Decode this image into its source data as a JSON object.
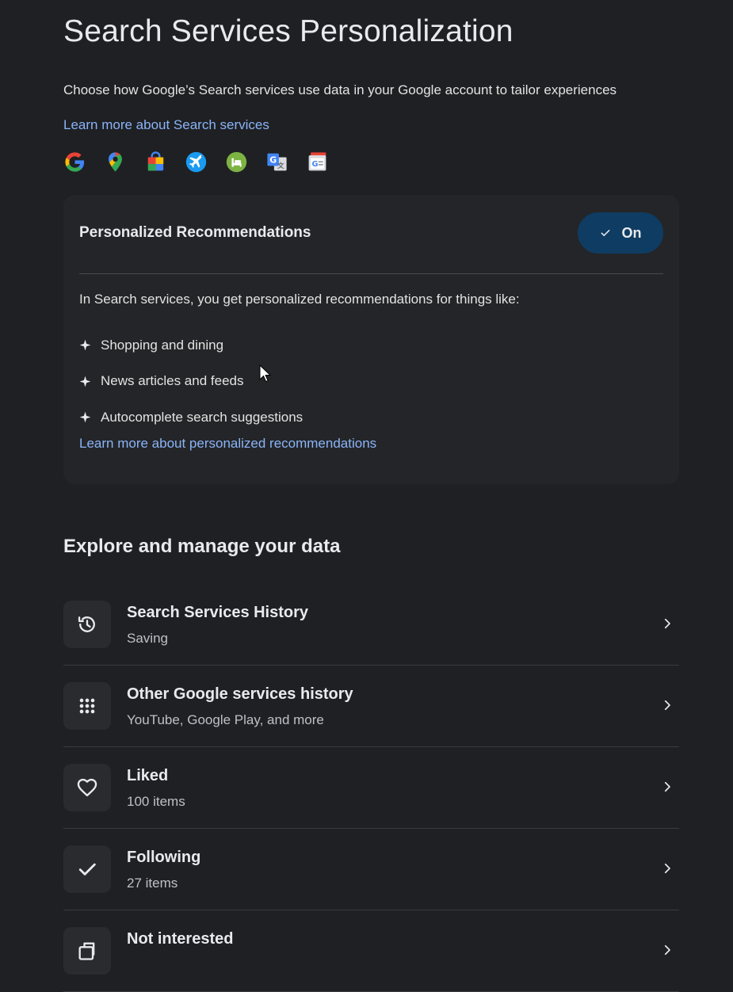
{
  "page": {
    "title": "Search Services Personalization",
    "intro": "Choose how Google’s Search services use data in your Google account to tailor experiences",
    "learn_more": "Learn more about Search services"
  },
  "service_icons": [
    "google-g-icon",
    "maps-pin-icon",
    "shopping-bag-icon",
    "flights-icon",
    "hotels-icon",
    "translate-icon",
    "news-icon"
  ],
  "recommendations": {
    "title": "Personalized Recommendations",
    "toggle_label": "On",
    "description": "In Search services, you get personalized recommendations for things like:",
    "items": [
      "Shopping and dining",
      "News articles and feeds",
      "Autocomplete search suggestions"
    ],
    "learn_more": "Learn more about personalized recommendations"
  },
  "explore": {
    "title": "Explore and manage your data",
    "rows": [
      {
        "title": "Search Services History",
        "subtitle": "Saving",
        "icon": "history-icon"
      },
      {
        "title": "Other Google services history",
        "subtitle": "YouTube, Google Play, and more",
        "icon": "apps-grid-icon"
      },
      {
        "title": "Liked",
        "subtitle": "100 items",
        "icon": "heart-icon"
      },
      {
        "title": "Following",
        "subtitle": "27 items",
        "icon": "check-icon"
      },
      {
        "title": "Not interested",
        "subtitle": "",
        "icon": "hide-icon"
      }
    ]
  },
  "colors": {
    "background": "#1f2023",
    "card": "#242528",
    "link": "#8ab4f8",
    "toggle_bg": "#0f3c63"
  }
}
